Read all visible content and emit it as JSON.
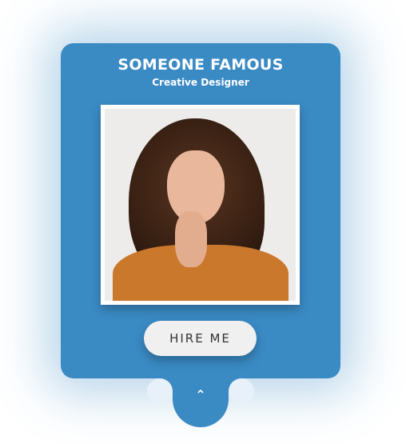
{
  "card": {
    "name": "SOMEONE FAMOUS",
    "role": "Creative Designer",
    "photo_alt": "portrait",
    "button_label": "HIRE ME",
    "toggle_icon": "chevron-up-icon",
    "accent_color": "#3a8ac4"
  }
}
